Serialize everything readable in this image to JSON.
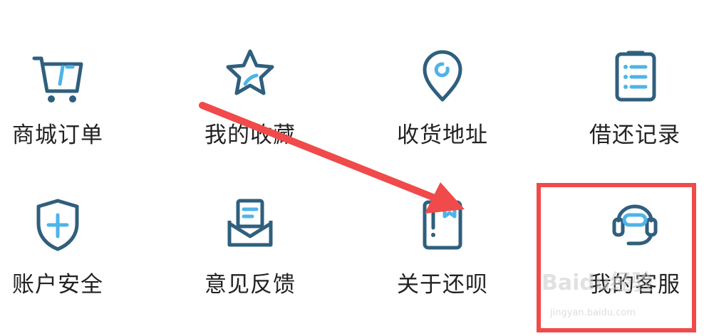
{
  "menu": {
    "items": [
      {
        "label": "商城订单",
        "icon": "shopping-cart-icon"
      },
      {
        "label": "我的收藏",
        "icon": "star-icon"
      },
      {
        "label": "收货地址",
        "icon": "location-pin-icon"
      },
      {
        "label": "借还记录",
        "icon": "clipboard-list-icon"
      },
      {
        "label": "账户安全",
        "icon": "shield-plus-icon"
      },
      {
        "label": "意见反馈",
        "icon": "envelope-letter-icon"
      },
      {
        "label": "关于还呗",
        "icon": "book-bookmark-icon"
      },
      {
        "label": "我的客服",
        "icon": "headset-service-icon"
      }
    ]
  },
  "colors": {
    "icon_dark": "#2f5f7e",
    "icon_accent": "#4fb3e8",
    "highlight": "#f04a4a"
  },
  "watermark": {
    "brand": "Baidu经验",
    "url": "jingyan.baidu.com"
  }
}
